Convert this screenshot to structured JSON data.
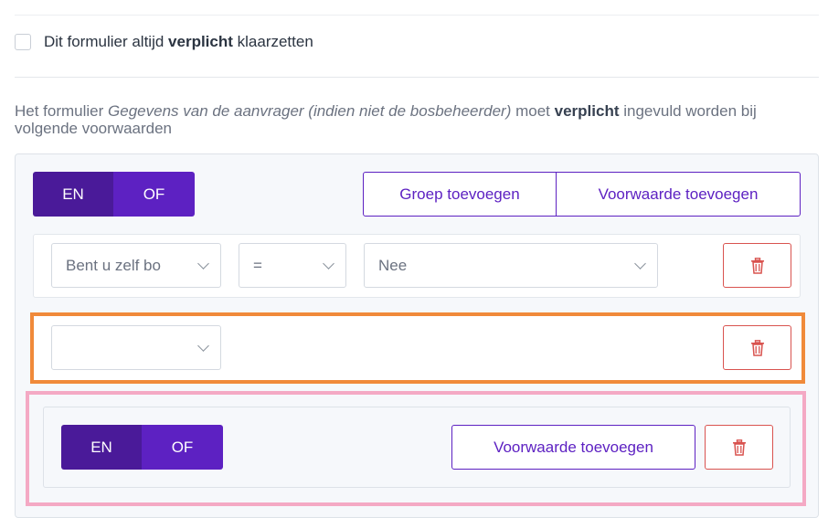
{
  "checkbox": {
    "label_pre": "Dit formulier altijd ",
    "label_bold": "verplicht",
    "label_post": " klaarzetten"
  },
  "description": {
    "pre": "Het formulier ",
    "form_name": "Gegevens van de aanvrager (indien niet de bosbeheerder)",
    "mid": " moet ",
    "bold": "verplicht",
    "post": " ingevuld worden bij volgende voorwaarden"
  },
  "group": {
    "toggle_en": "EN",
    "toggle_of": "OF",
    "add_group_label": "Groep toevoegen",
    "add_condition_label": "Voorwaarde toevoegen"
  },
  "conditions": [
    {
      "field": "Bent u zelf bo",
      "operator": "=",
      "value": "Nee"
    },
    {
      "field": ""
    }
  ],
  "nested_group": {
    "toggle_en": "EN",
    "toggle_of": "OF",
    "add_condition_label": "Voorwaarde toevoegen"
  },
  "icons": {
    "trash": "trash-icon",
    "chevron": "chevron-down-icon"
  },
  "colors": {
    "primary": "#5d21c2",
    "primary_dark": "#4a1a99",
    "danger": "#d9534f",
    "highlight_orange": "#f08a3a",
    "highlight_pink": "#f4a9c4"
  }
}
